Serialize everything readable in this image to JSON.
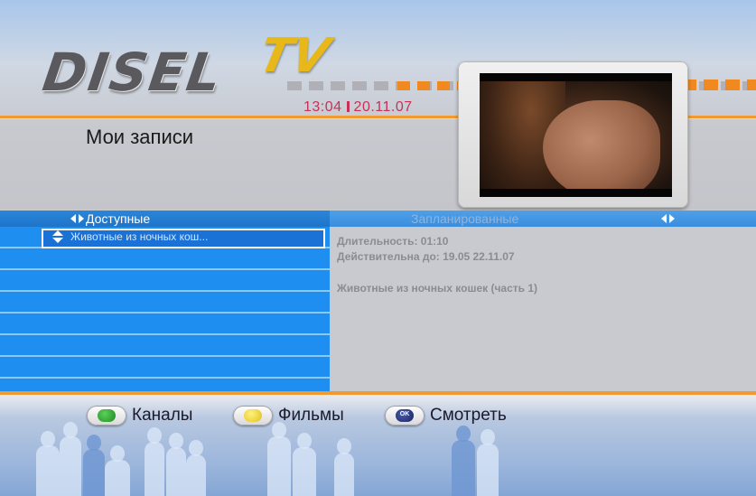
{
  "header": {
    "logo_main": "DISEL",
    "logo_suffix": "TV",
    "time": "13:04",
    "date": "20.11.07",
    "page_title": "Мои записи"
  },
  "tabs": {
    "available_label": "Доступные",
    "scheduled_label": "Запланированные"
  },
  "recordings": {
    "items": [
      "Животные из ночных кош..."
    ],
    "selected_index": 0
  },
  "details": {
    "duration": "Длительность: 01:10",
    "valid_until": "Действительна до: 19.05 22.11.07",
    "description": "Животные из ночных кошек (часть 1)"
  },
  "footer": {
    "channels_label": "Каналы",
    "movies_label": "Фильмы",
    "ok_glyph": "OK",
    "watch_label": "Смотреть"
  },
  "colors": {
    "accent_orange": "#f09a30",
    "list_blue": "#1e8ef0",
    "time_color": "#c8305a",
    "green_key": "#2a9a2a",
    "yellow_key": "#e8cc30"
  }
}
